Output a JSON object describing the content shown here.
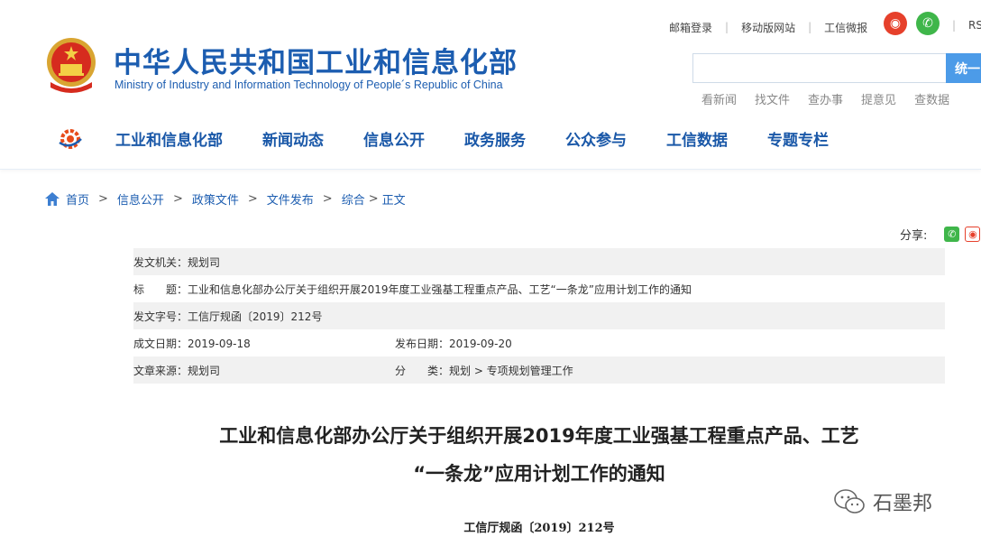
{
  "header": {
    "site_title": "中华人民共和国工业和信息化部",
    "site_subtitle": "Ministry of Industry and Information Technology of People´s Republic of China",
    "top_links": [
      "邮箱登录",
      "移动版网站",
      "工信微报"
    ],
    "rss": "RS",
    "search": {
      "value": "",
      "placeholder": "",
      "button_label": "统一"
    },
    "quick_links": [
      "看新闻",
      "找文件",
      "查办事",
      "提意见",
      "查数据"
    ]
  },
  "nav": {
    "items": [
      "工业和信息化部",
      "新闻动态",
      "信息公开",
      "政务服务",
      "公众参与",
      "工信数据",
      "专题专栏"
    ]
  },
  "breadcrumb": {
    "items": [
      "首页",
      "信息公开",
      "政策文件",
      "文件发布",
      "综合"
    ],
    "current": "正文",
    "separator": ">"
  },
  "share": {
    "label": "分享:"
  },
  "meta": {
    "issuer": "发文机关：规划司",
    "title": "标　　题：工业和信息化部办公厅关于组织开展2019年度工业强基工程重点产品、工艺“一条龙”应用计划工作的通知",
    "doc_no": "发文字号：工信厅规函〔2019〕212号",
    "created": "成文日期：2019-09-18",
    "published": "发布日期：2019-09-20",
    "source": "文章来源：规划司",
    "category": "分　　类：规划 > 专项规划管理工作"
  },
  "article": {
    "title_line1": "工业和信息化部办公厅关于组织开展2019年度工业强基工程重点产品、工艺",
    "title_line2": "“一条龙”应用计划工作的通知",
    "doc_number": "工信厅规函〔2019〕212号"
  },
  "watermark": {
    "text": "石墨邦"
  },
  "colors": {
    "brand_blue": "#1c5db0",
    "nav_blue": "#1a58a8",
    "search_button": "#4c9be8",
    "weibo_red": "#e6402b",
    "wechat_green": "#3fb64a"
  }
}
